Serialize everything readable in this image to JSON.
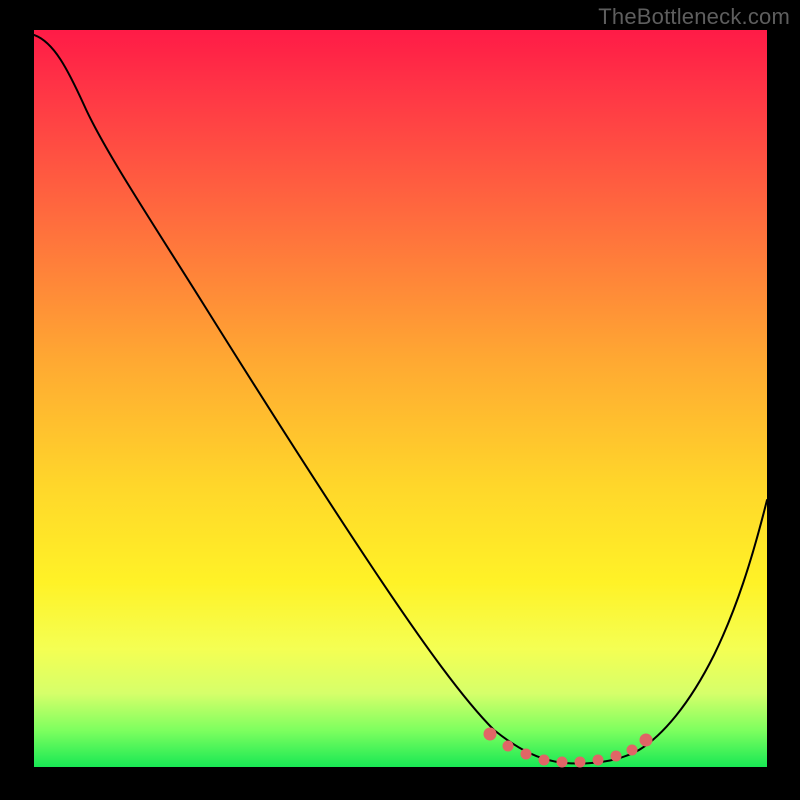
{
  "watermark": "TheBottleneck.com",
  "colors": {
    "page_bg": "#000000",
    "gradient_top": "#ff1b47",
    "gradient_bottom": "#18e854",
    "curve": "#000000",
    "dot": "#e06666"
  },
  "chart_data": {
    "type": "line",
    "title": "",
    "xlabel": "",
    "ylabel": "",
    "xlim": [
      0,
      100
    ],
    "ylim": [
      0,
      100
    ],
    "grid": false,
    "legend": false,
    "background": "vertical-gradient red→orange→yellow→green",
    "series": [
      {
        "name": "bottleneck-curve",
        "x": [
          0,
          4,
          8,
          12,
          16,
          20,
          24,
          28,
          32,
          36,
          40,
          44,
          48,
          52,
          56,
          60,
          64,
          68,
          72,
          76,
          80,
          84,
          88,
          92,
          96,
          100
        ],
        "y": [
          99,
          98,
          91,
          85,
          79,
          73,
          67,
          61,
          55,
          49,
          43,
          36,
          30,
          24,
          17,
          11,
          6,
          3,
          1,
          1,
          2,
          5,
          11,
          19,
          29,
          41
        ]
      }
    ],
    "markers": [
      {
        "x": 62,
        "y": 4
      },
      {
        "x": 65,
        "y": 2
      },
      {
        "x": 67,
        "y": 1.5
      },
      {
        "x": 70,
        "y": 1
      },
      {
        "x": 73,
        "y": 1
      },
      {
        "x": 75,
        "y": 1
      },
      {
        "x": 78,
        "y": 1.5
      },
      {
        "x": 80,
        "y": 2
      },
      {
        "x": 82,
        "y": 3
      },
      {
        "x": 83.5,
        "y": 4.5
      }
    ]
  }
}
